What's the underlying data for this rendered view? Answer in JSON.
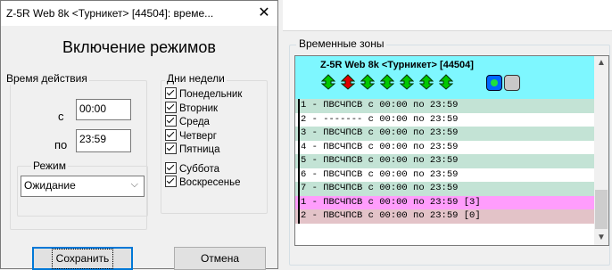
{
  "dialog": {
    "title": "Z-5R Web 8k <Турникет> [44504]: време...",
    "close_glyph": "✕",
    "heading": "Включение режимов",
    "time_group": {
      "label": "Время действия",
      "from_label": "с",
      "from_value": "00:00",
      "to_label": "по",
      "to_value": "23:59"
    },
    "mode_group": {
      "label": "Режим",
      "selected": "Ожидание"
    },
    "days_group": {
      "label": "Дни недели",
      "days": [
        {
          "label": "Понедельник",
          "checked": true
        },
        {
          "label": "Вторник",
          "checked": true
        },
        {
          "label": "Среда",
          "checked": true
        },
        {
          "label": "Четверг",
          "checked": true
        },
        {
          "label": "Пятница",
          "checked": true
        },
        {
          "label": "Суббота",
          "checked": true
        },
        {
          "label": "Воскресенье",
          "checked": true
        }
      ]
    },
    "save_label": "Сохранить",
    "cancel_label": "Отмена"
  },
  "zones": {
    "group_label": "Временные зоны",
    "device_title": "Z-5R Web 8k <Турникет> [44504]",
    "arrow_colors": [
      "#00c800",
      "#e00000",
      "#00c800",
      "#00c800",
      "#00c800",
      "#00c800",
      "#00c800"
    ],
    "rows": [
      {
        "text": "1 - ПВСЧПСВ с 00:00 по 23:59",
        "bg": "#c3e3d5"
      },
      {
        "text": "2 - ------- с 00:00 по 23:59",
        "bg": "#ffffff"
      },
      {
        "text": "3 - ПВСЧПСВ с 00:00 по 23:59",
        "bg": "#c3e3d5"
      },
      {
        "text": "4 - ПВСЧПСВ с 00:00 по 23:59",
        "bg": "#ffffff"
      },
      {
        "text": "5 - ПВСЧПСВ с 00:00 по 23:59",
        "bg": "#c3e3d5"
      },
      {
        "text": "6 - ПВСЧПСВ с 00:00 по 23:59",
        "bg": "#ffffff"
      },
      {
        "text": "7 - ПВСЧПСВ с 00:00 по 23:59",
        "bg": "#c3e3d5"
      },
      {
        "text": "1 - ПВСЧПСВ с 00:00 по 23:59 [3]",
        "bg": "#ff9dfc"
      },
      {
        "text": "2 - ПВСЧПСВ с 00:00 по 23:59 [0]",
        "bg": "#e3c3c8"
      }
    ]
  }
}
